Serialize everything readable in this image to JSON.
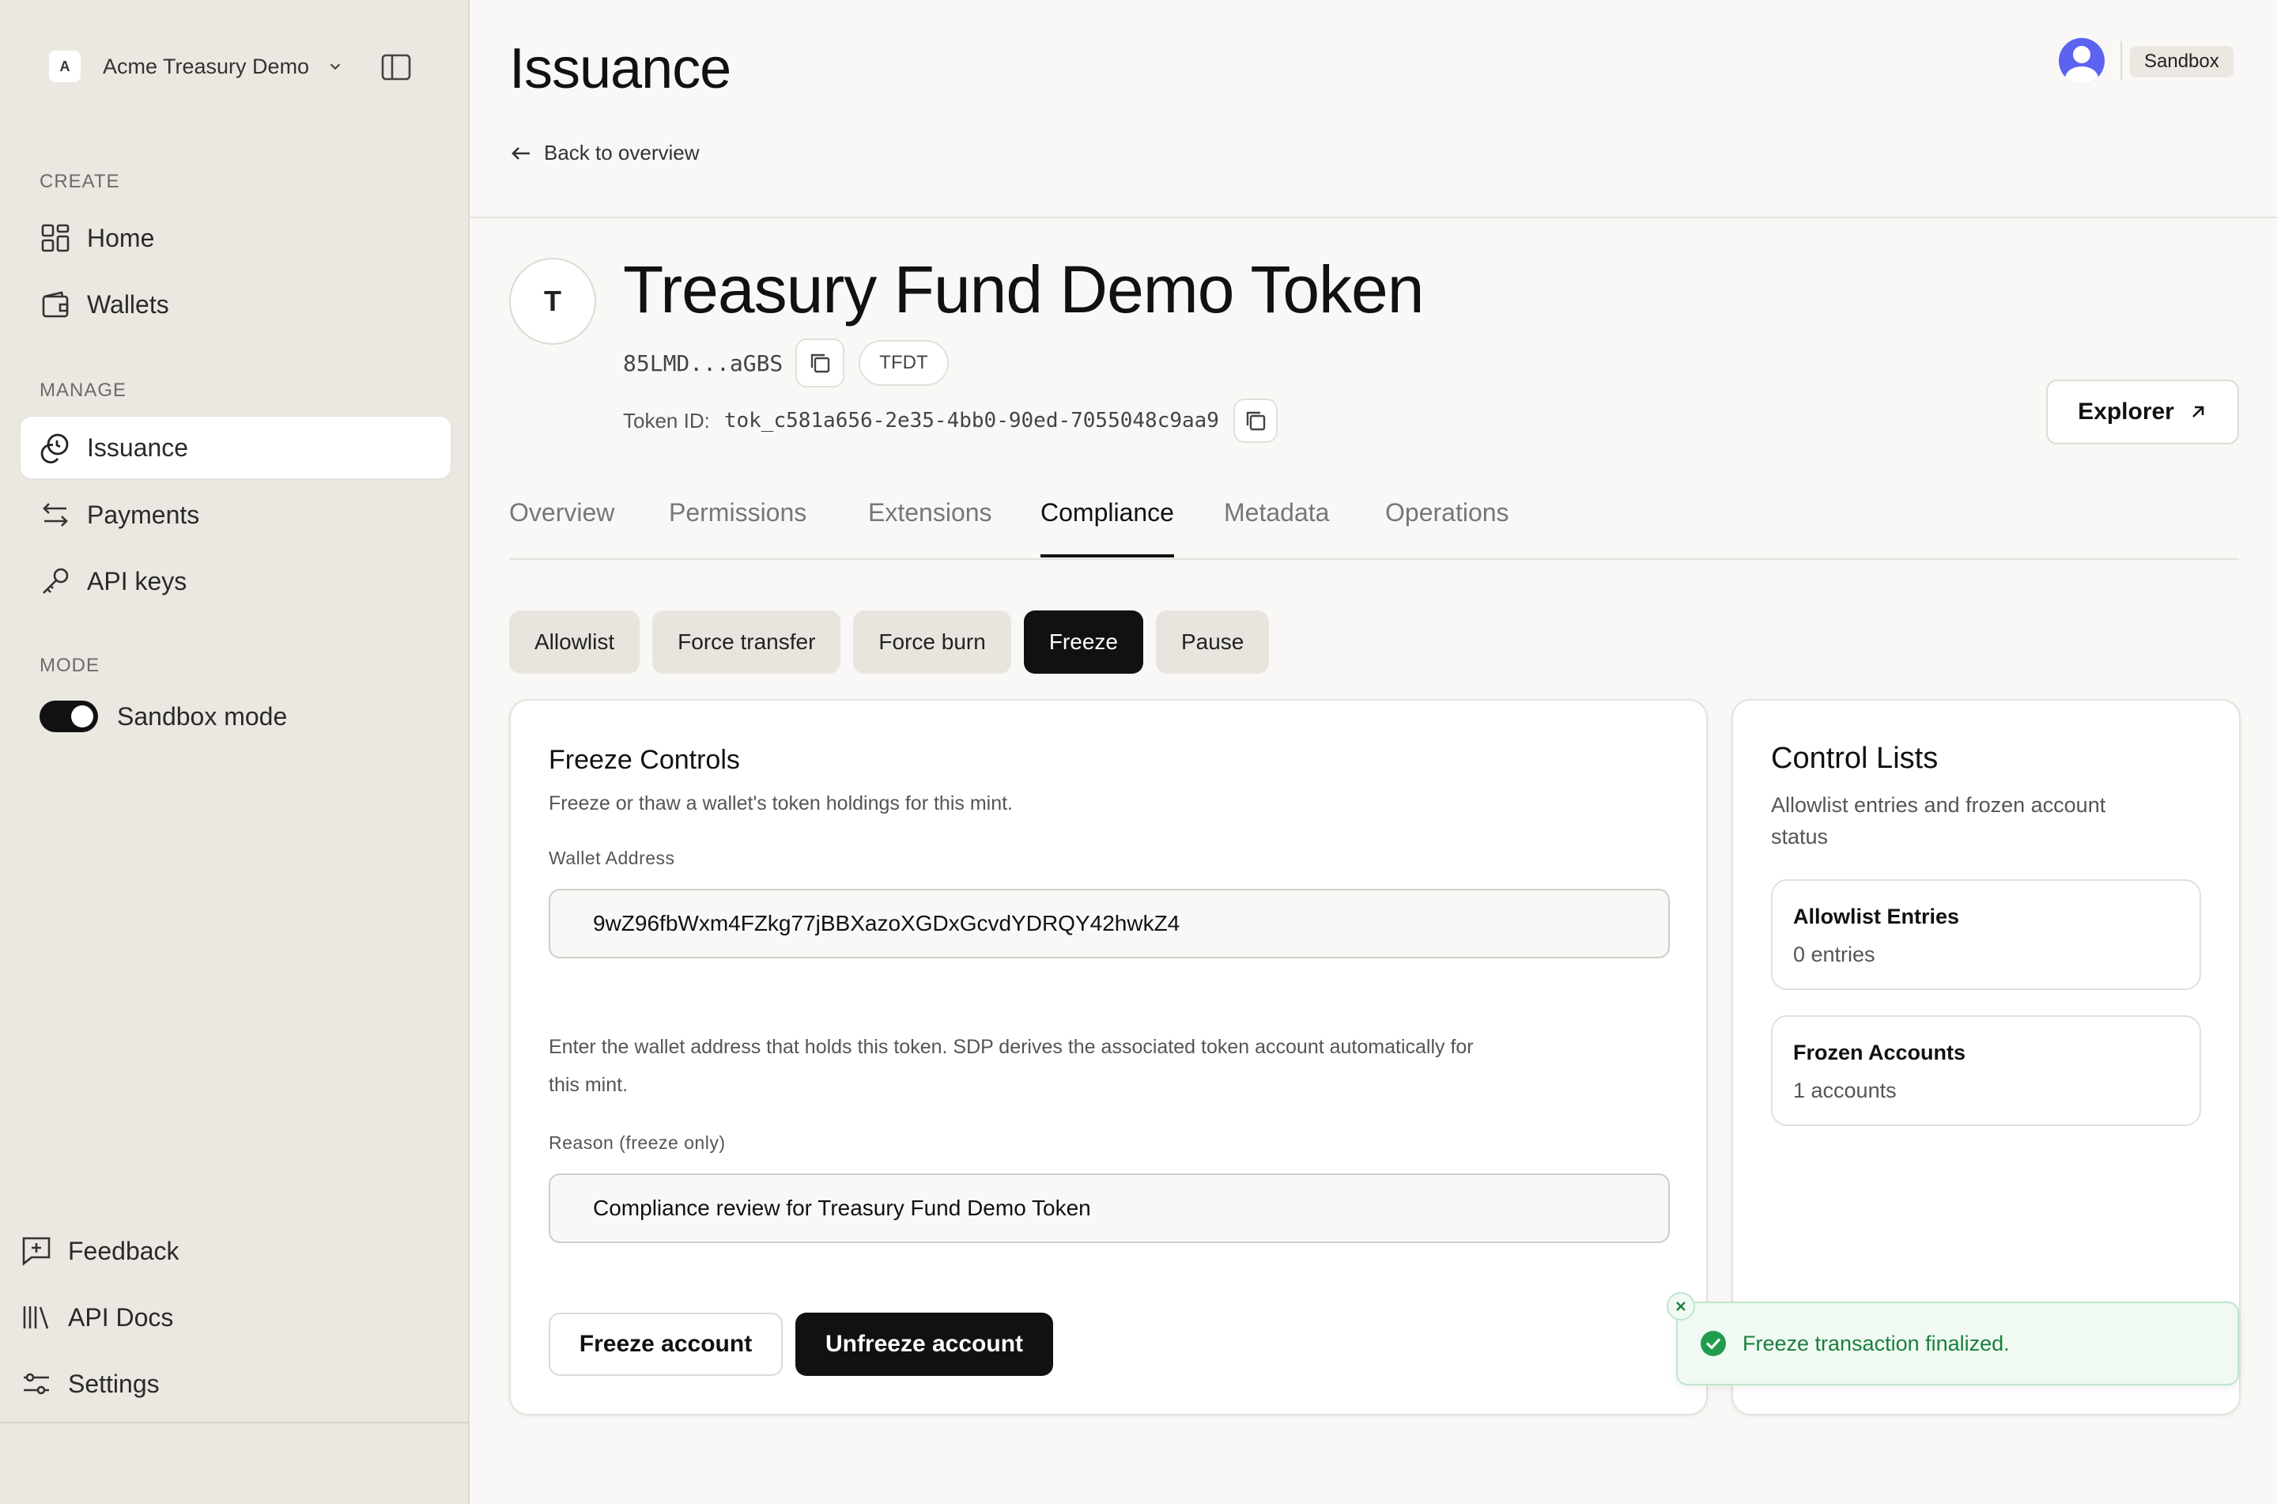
{
  "org": {
    "logo": "A",
    "name": "Acme Treasury Demo"
  },
  "sidebar": {
    "section_create": "CREATE",
    "section_manage": "MANAGE",
    "section_mode": "MODE",
    "items": [
      {
        "label": "Home",
        "icon": "grid-icon"
      },
      {
        "label": "Wallets",
        "icon": "wallet-icon"
      },
      {
        "label": "Issuance",
        "icon": "coins-icon",
        "active": true
      },
      {
        "label": "Payments",
        "icon": "arrows-icon"
      },
      {
        "label": "API keys",
        "icon": "key-icon"
      }
    ],
    "sandbox_label": "Sandbox mode",
    "sandbox_on": true,
    "bottom": [
      {
        "label": "Feedback",
        "icon": "feedback-icon"
      },
      {
        "label": "API Docs",
        "icon": "library-icon"
      },
      {
        "label": "Settings",
        "icon": "sliders-icon"
      }
    ]
  },
  "header": {
    "title": "Issuance",
    "back_label": "Back to overview",
    "env_badge": "Sandbox"
  },
  "token": {
    "avatar_letter": "T",
    "name": "Treasury Fund Demo Token",
    "address_short": "85LMD...aGBS",
    "symbol": "TFDT",
    "id_label": "Token ID:",
    "id_value": "tok_c581a656-2e35-4bb0-90ed-7055048c9aa9",
    "explorer_label": "Explorer"
  },
  "tabs": [
    "Overview",
    "Permissions",
    "Extensions",
    "Compliance",
    "Metadata",
    "Operations"
  ],
  "active_tab": "Compliance",
  "subtabs": [
    "Allowlist",
    "Force transfer",
    "Force burn",
    "Freeze",
    "Pause"
  ],
  "active_subtab": "Freeze",
  "freeze": {
    "title": "Freeze Controls",
    "description": "Freeze or thaw a wallet's token holdings for this mint.",
    "wallet_label": "Wallet Address",
    "wallet_value": "9wZ96fbWxm4FZkg77jBBXazoXGDxGcvdYDRQY42hwkZ4",
    "help_line1": "Enter the wallet address that holds this token. SDP derives the associated token account automatically for",
    "help_line2": "this mint.",
    "reason_label": "Reason (freeze only)",
    "reason_value": "Compliance review for Treasury Fund Demo Token",
    "freeze_button": "Freeze account",
    "unfreeze_button": "Unfreeze account"
  },
  "control_lists": {
    "title": "Control Lists",
    "desc_line1": "Allowlist entries and frozen account",
    "desc_line2": "status",
    "allowlist_title": "Allowlist Entries",
    "allowlist_value": "0 entries",
    "frozen_title": "Frozen Accounts",
    "frozen_value": "1 accounts"
  },
  "toast": {
    "message": "Freeze transaction finalized.",
    "color": "#1a7f3c"
  },
  "colors": {
    "accent": "#111111",
    "avatar": "#5b63f0",
    "success": "#1a7f3c"
  }
}
